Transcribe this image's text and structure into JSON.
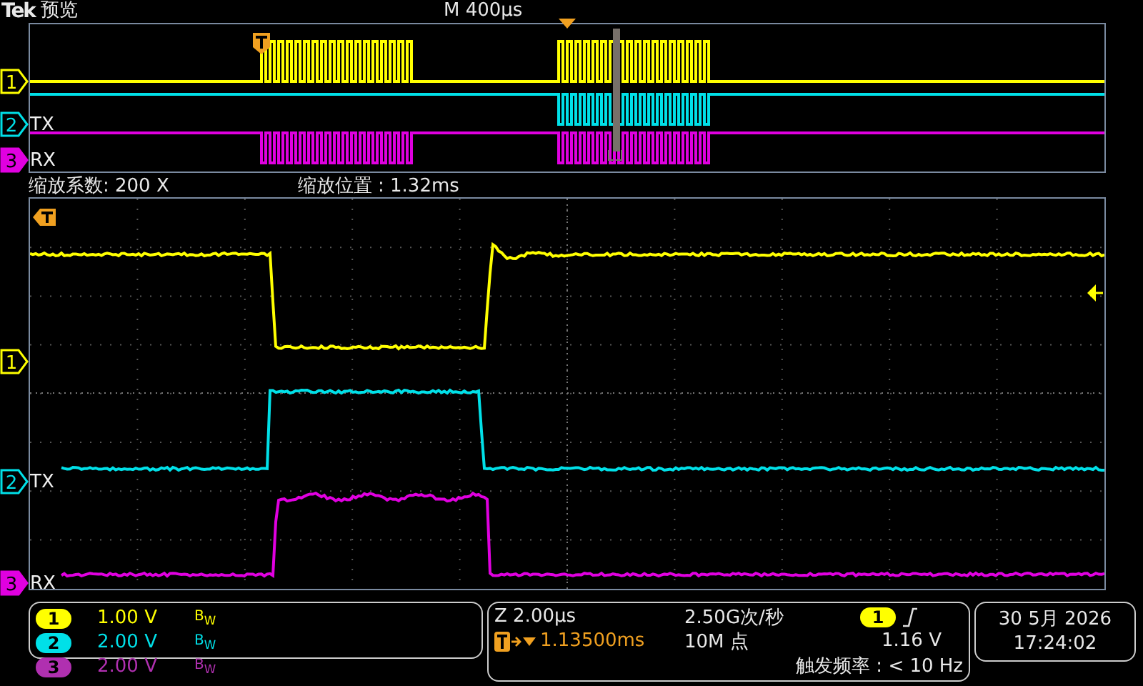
{
  "header": {
    "brand": "Tek",
    "mode": "预览",
    "timebase": "M 400μs"
  },
  "overview": {
    "markers": [
      {
        "number": "1",
        "color": "#ffff00",
        "selected": false
      },
      {
        "number": "2",
        "label": "TX",
        "color": "#00e0e8",
        "selected": false
      },
      {
        "number": "3",
        "label": "RX",
        "color": "#e000e0",
        "selected": true
      }
    ]
  },
  "zoom": {
    "factor": "缩放系数: 200 X",
    "position": "缩放位置 : 1.32ms"
  },
  "main": {
    "markers": [
      {
        "number": "1",
        "color": "#ffff00",
        "selected": false
      },
      {
        "number": "2",
        "label": "TX",
        "color": "#00e0e8",
        "selected": false
      },
      {
        "number": "3",
        "label": "RX",
        "color": "#e000e0",
        "selected": true
      }
    ]
  },
  "readout": {
    "channels": [
      {
        "number": "1",
        "scale": "1.00 V",
        "bandwidth": "B$_{W}$",
        "color": "#ffff00"
      },
      {
        "number": "2",
        "scale": "2.00 V",
        "bandwidth": "B$_{W}$",
        "color": "#00e0e8"
      },
      {
        "number": "3",
        "scale": "2.00 V",
        "bandwidth": "B$_{W}$",
        "color": "#b030b0"
      }
    ]
  },
  "acquisition": {
    "zoom_scale": "Z 2.00μs",
    "trigger_position": "1.13500ms",
    "sample_rate": "2.50G次/秒",
    "record_length": "10M 点",
    "trigger_source": {
      "number": "1",
      "color": "#ffff00"
    },
    "trigger_level": "1.16 V",
    "trigger_frequency": "触发频率 : < 10 Hz"
  },
  "clock": {
    "date": "30 5月 2026",
    "time": "17:24:02"
  }
}
